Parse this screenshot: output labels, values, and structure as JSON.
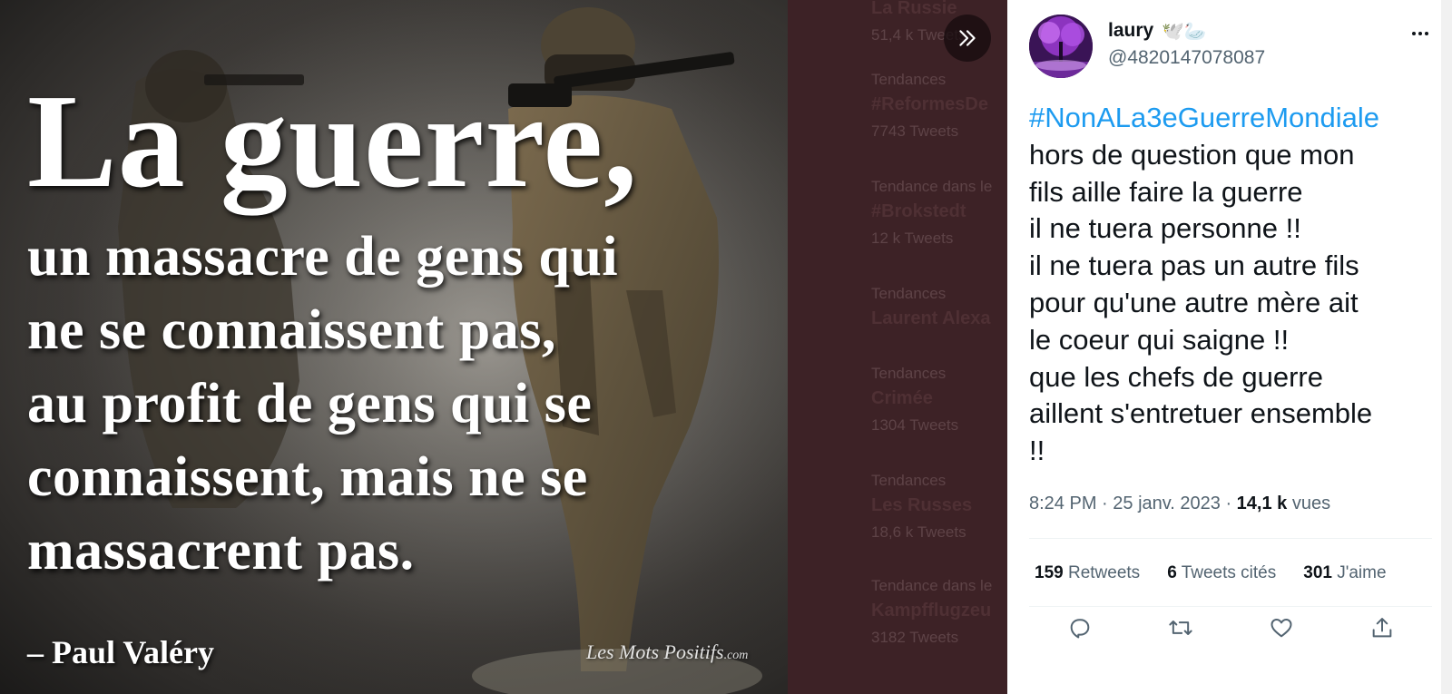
{
  "media": {
    "quote_big": "La guerre,",
    "quote_lines": [
      "un massacre de gens qui",
      "ne se connaissent pas,",
      "au profit de gens qui se",
      "connaissent, mais ne se",
      "massacrent pas."
    ],
    "author": "– Paul Valéry",
    "watermark_main": "Les Mots Positifs",
    "watermark_suffix": ".com"
  },
  "background_trends": [
    {
      "context": "",
      "name": "La Russie",
      "count": "51,4 k Tweets"
    },
    {
      "context": "Tendances",
      "name": "#ReformesDe",
      "count": "7743 Tweets"
    },
    {
      "context": "Tendance dans le",
      "name": "#Brokstedt",
      "count": "12 k Tweets"
    },
    {
      "context": "Tendances",
      "name": "Laurent Alexa",
      "count": ""
    },
    {
      "context": "Tendances",
      "name": "Crimée",
      "count": "1304 Tweets"
    },
    {
      "context": "Tendances",
      "name": "Les Russes",
      "count": "18,6 k Tweets"
    },
    {
      "context": "Tendance dans le",
      "name": "Kampfflugzeu",
      "count": "3182 Tweets"
    }
  ],
  "tweet": {
    "display_name": "laury",
    "name_emojis": "🕊️🦢",
    "handle": "@4820147078087",
    "hashtag": "#NonALa3eGuerreMondiale",
    "lines": [
      "hors de question que mon",
      "fils aille faire la guerre",
      "il ne tuera personne !!",
      "il ne tuera pas un autre fils",
      "pour qu'une autre mère ait",
      "le coeur qui saigne !!",
      "que les chefs de guerre",
      "aillent s'entretuer ensemble",
      "!!"
    ],
    "time": "8:24 PM",
    "sep1": " · ",
    "date": "25 janv. 2023",
    "sep2": " · ",
    "views_count": "14,1 k",
    "views_label": " vues",
    "retweets_count": "159",
    "retweets_label": " Retweets",
    "quotes_count": "6",
    "quotes_label": " Tweets cités",
    "likes_count": "301",
    "likes_label": " J'aime"
  },
  "icons": {
    "collapse": "double-chevron-right-icon",
    "more": "more-dots-icon",
    "reply": "reply-icon",
    "retweet": "retweet-icon",
    "like": "heart-icon",
    "share": "share-icon"
  },
  "colors": {
    "accent": "#1d9bf0",
    "text": "#0f1419",
    "secondary": "#536471",
    "overlay": "#3d2226"
  }
}
